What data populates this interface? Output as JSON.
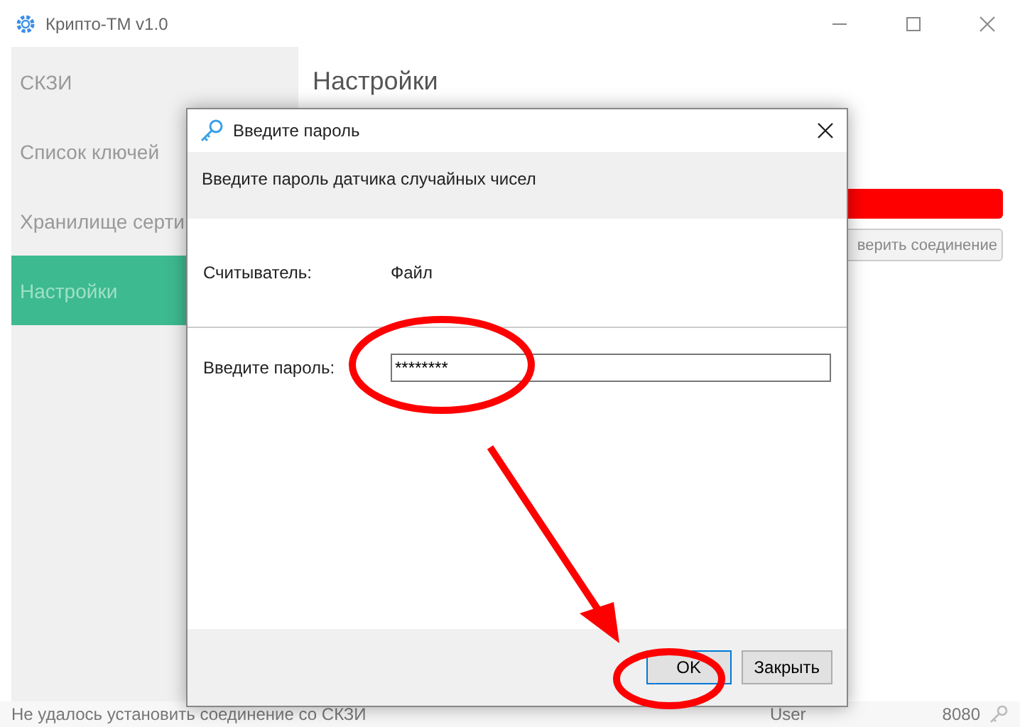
{
  "window": {
    "title": "Крипто-ТМ v1.0"
  },
  "sidebar": {
    "items": [
      {
        "label": "СКЗИ",
        "selected": false
      },
      {
        "label": "Список ключей",
        "selected": false
      },
      {
        "label": "Хранилище серти",
        "selected": false
      },
      {
        "label": "Настройки",
        "selected": true
      }
    ]
  },
  "content": {
    "heading": "Настройки",
    "button": "верить соединение"
  },
  "dialog": {
    "title": "Введите пароль",
    "header": "Введите пароль датчика случайных чисел",
    "fields": [
      {
        "kind": "text",
        "label": "Считыватель:",
        "value": "Файл"
      },
      {
        "kind": "input",
        "label": "Введите пароль:",
        "value": "********"
      }
    ],
    "buttons": [
      "OK",
      "Закрыть"
    ]
  },
  "status_bar": {
    "message": "Не удалось установить соединение со СКЗИ",
    "user": "User",
    "port": "8080"
  }
}
